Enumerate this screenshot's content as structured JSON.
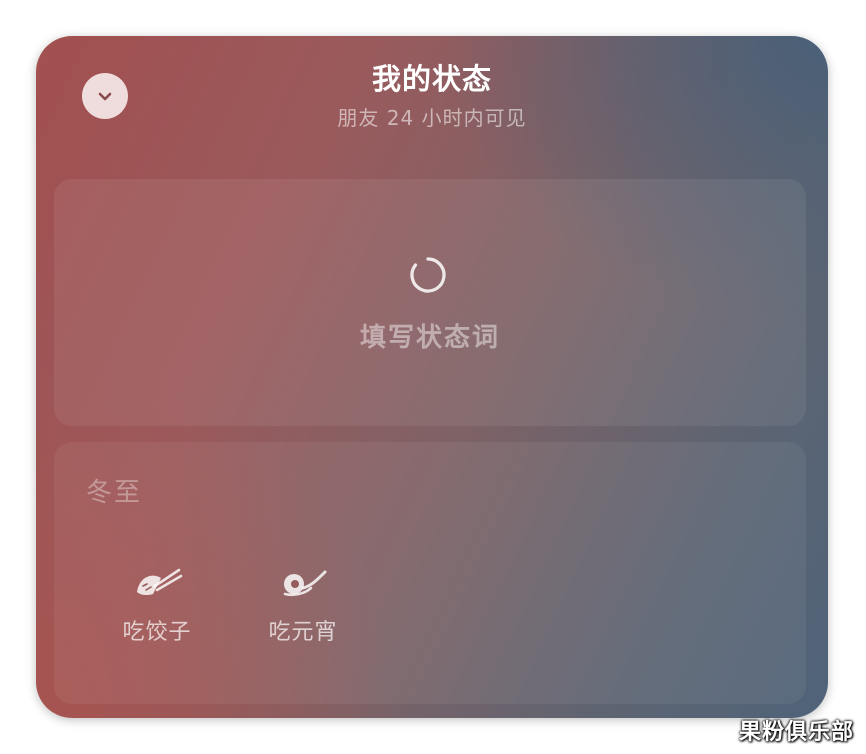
{
  "header": {
    "title": "我的状态",
    "subtitle": "朋友 24 小时内可见",
    "collapse_icon": "chevron-down-icon"
  },
  "status_input": {
    "prompt": "填写状态词",
    "icon": "loading-spinner-icon"
  },
  "season_section": {
    "label": "冬至",
    "options": [
      {
        "label": "吃饺子",
        "icon": "dumpling-icon"
      },
      {
        "label": "吃元宵",
        "icon": "tangyuan-icon"
      }
    ]
  },
  "watermark": "果粉俱乐部",
  "colors": {
    "gradient_warm": "#a24f4f",
    "gradient_cool": "#4f6379",
    "button_bg": "#f5e8e8",
    "text_primary": "#ffffff"
  }
}
